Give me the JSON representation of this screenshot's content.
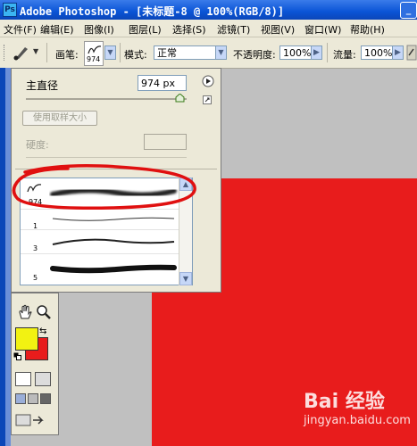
{
  "window": {
    "title": "Adobe Photoshop - [未标题-8 @ 100%(RGB/8)]",
    "app_icon": "Ps"
  },
  "menubar": {
    "items": [
      {
        "label": "文件(F)"
      },
      {
        "label": "编辑(E)"
      },
      {
        "label": "图像(I)"
      },
      {
        "label": "图层(L)"
      },
      {
        "label": "选择(S)"
      },
      {
        "label": "滤镜(T)"
      },
      {
        "label": "视图(V)"
      },
      {
        "label": "窗口(W)"
      },
      {
        "label": "帮助(H)"
      }
    ]
  },
  "options": {
    "brush_label": "画笔:",
    "brush_size": "974",
    "mode_label": "模式:",
    "mode_value": "正常",
    "opacity_label": "不透明度:",
    "opacity_value": "100%",
    "flow_label": "流量:",
    "flow_value": "100%"
  },
  "brush_panel": {
    "diameter_label": "主直径",
    "diameter_value": "974 px",
    "use_sample_size": "使用取样大小",
    "hardness_label": "硬度:",
    "slider_value": 0.97,
    "brushes": [
      {
        "num": "974"
      },
      {
        "num": "1"
      },
      {
        "num": "3"
      },
      {
        "num": "5"
      }
    ]
  },
  "colors": {
    "foreground": "#f2f212",
    "background": "#e81c1c",
    "canvas": "#e81c1c",
    "annotation": "#e01010"
  },
  "watermark": {
    "brand": "Bai 经验",
    "url": "jingyan.baidu.com"
  }
}
